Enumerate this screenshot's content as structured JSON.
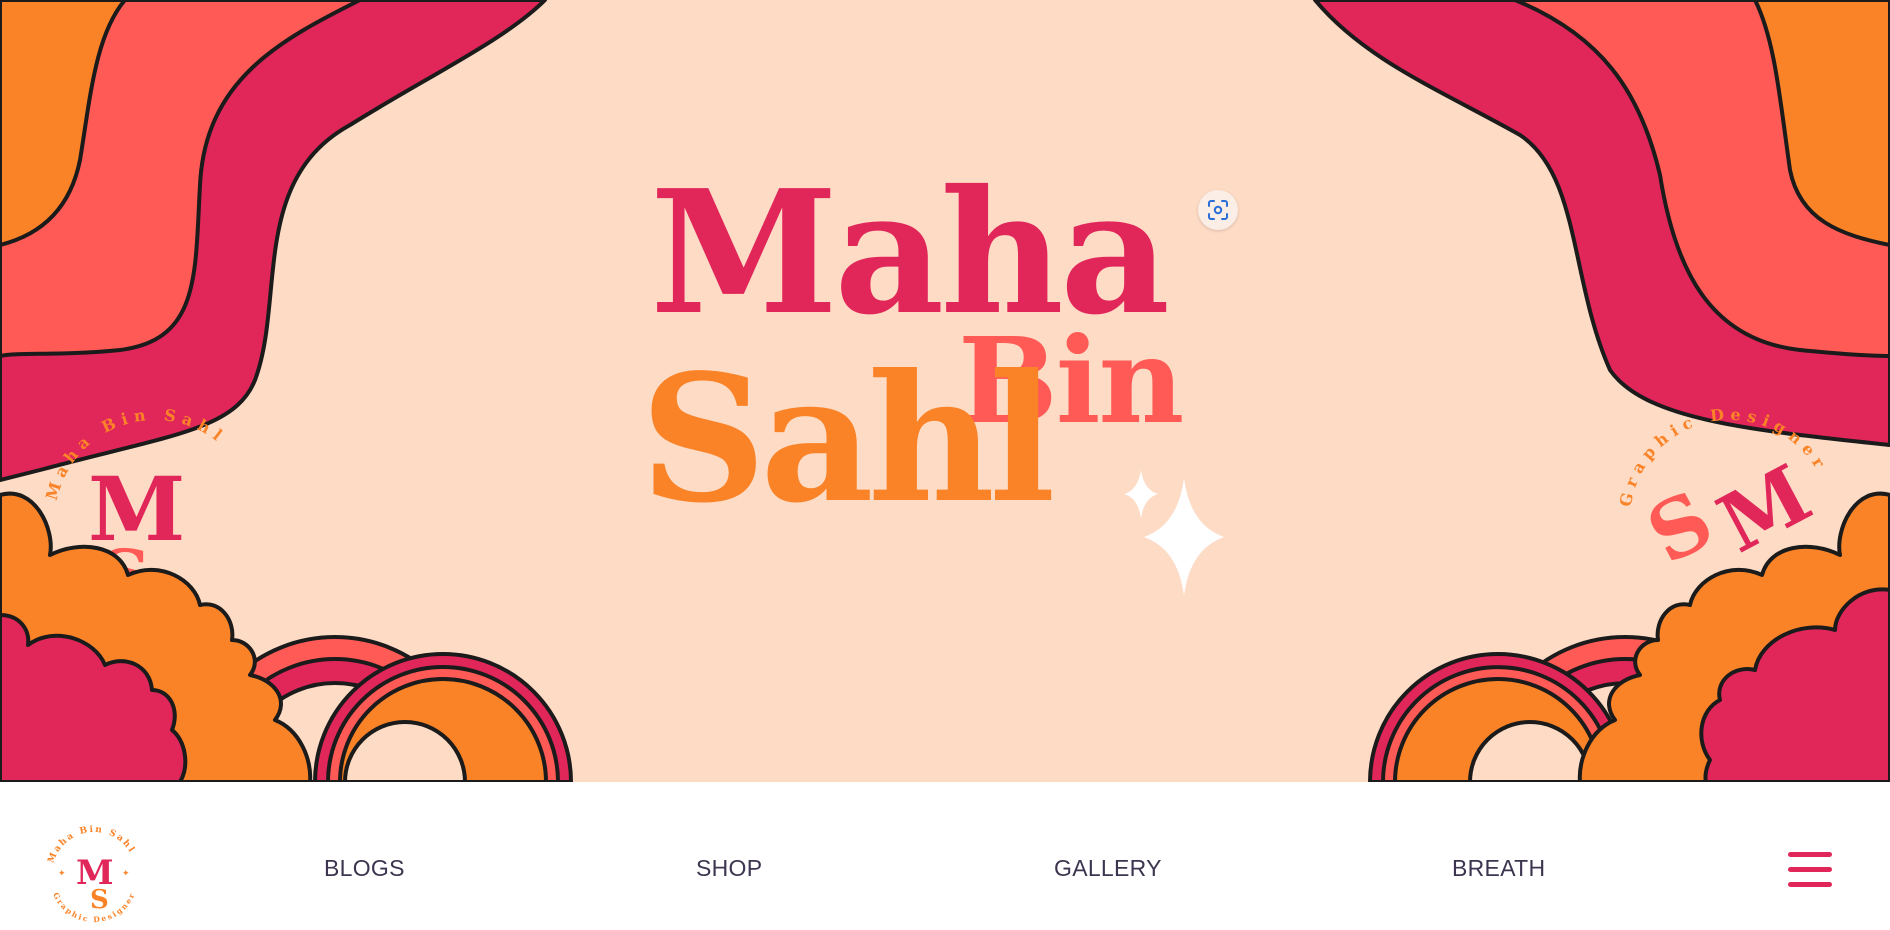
{
  "hero": {
    "brand_name": {
      "line1": "Maha",
      "line2": "Bin",
      "line3": "Sahl"
    },
    "left_badge_text": "Maha Bin Sahl",
    "right_badge_text": "Graphic Designer",
    "monogram": {
      "letter_top": "M",
      "letter_bottom": "S"
    },
    "lens_icon": "visual-search-icon"
  },
  "navbar": {
    "logo_ring_text_top": "Maha Bin Sahl",
    "logo_ring_text_bottom": "Graphic Designer",
    "logo_letters": {
      "top": "M",
      "bottom": "S"
    },
    "links": {
      "blogs": "BLOGS",
      "shop": "SHOP",
      "gallery": "GALLERY",
      "breath": "BREATH"
    },
    "menu_icon": "hamburger-menu-icon"
  },
  "colors": {
    "background": "#fddbc5",
    "magenta": "#e1265a",
    "coral": "#ff5a55",
    "orange": "#fb8327",
    "outline": "#1b1b1b",
    "nav_text": "#3d3550"
  }
}
